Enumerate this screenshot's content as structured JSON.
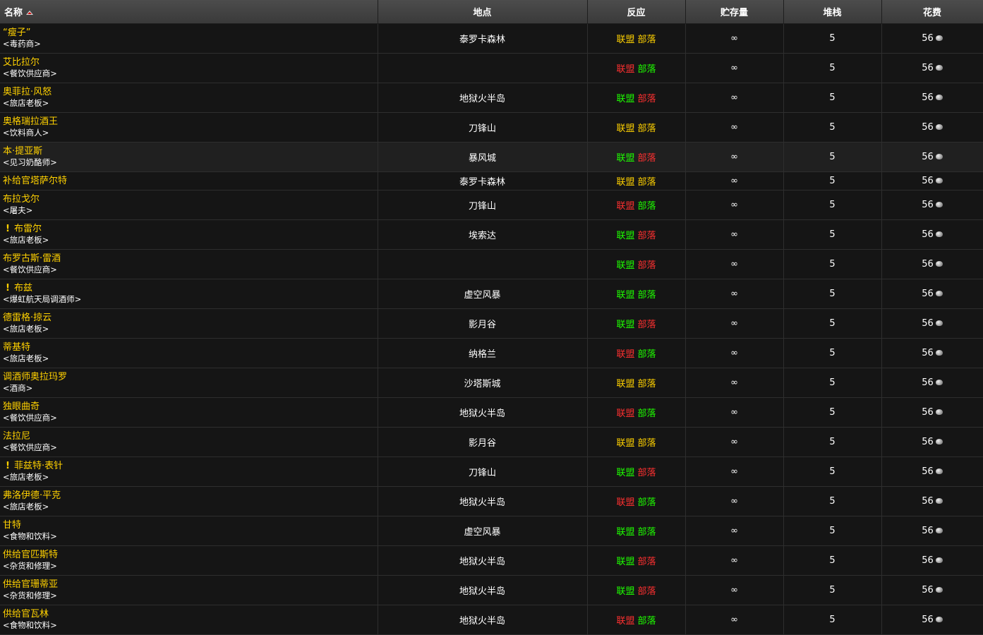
{
  "headers": {
    "name": "名称",
    "location": "地点",
    "reaction": "反应",
    "stock": "贮存量",
    "stack": "堆栈",
    "cost": "花费"
  },
  "reaction_labels": {
    "alliance": "联盟",
    "horde": "部落"
  },
  "colors": {
    "alliance_yellow": "#ffd100",
    "friendly_green": "#1eff00",
    "hostile_red": "#ff3030",
    "name_gold": "#ffd100"
  },
  "rows": [
    {
      "name": "“瘦子”",
      "title": "<毒药商>",
      "quest": false,
      "location": "泰罗卡森林",
      "alliance": "yellow",
      "horde": "yellow",
      "stock": "∞",
      "stack": "5",
      "cost": "56"
    },
    {
      "name": "艾比拉尔",
      "title": "<餐饮供应商>",
      "quest": false,
      "location": "",
      "alliance": "red",
      "horde": "green",
      "stock": "∞",
      "stack": "5",
      "cost": "56"
    },
    {
      "name": "奥菲拉·风怒",
      "title": "<旅店老板>",
      "quest": false,
      "location": "地狱火半岛",
      "alliance": "green",
      "horde": "red",
      "stock": "∞",
      "stack": "5",
      "cost": "56"
    },
    {
      "name": "奥格瑞拉酒王",
      "title": "<饮料商人>",
      "quest": false,
      "location": "刀锋山",
      "alliance": "yellow",
      "horde": "yellow",
      "stock": "∞",
      "stack": "5",
      "cost": "56"
    },
    {
      "name": "本·提亚斯",
      "title": "<见习奶酪师>",
      "quest": false,
      "location": "暴风城",
      "alliance": "green",
      "horde": "red",
      "stock": "∞",
      "stack": "5",
      "cost": "56",
      "highlight": true
    },
    {
      "name": "补给官塔萨尔特",
      "title": "",
      "quest": false,
      "location": "泰罗卡森林",
      "alliance": "yellow",
      "horde": "yellow",
      "stock": "∞",
      "stack": "5",
      "cost": "56",
      "short": true
    },
    {
      "name": "布拉戈尔",
      "title": "<屠夫>",
      "quest": false,
      "location": "刀锋山",
      "alliance": "red",
      "horde": "green",
      "stock": "∞",
      "stack": "5",
      "cost": "56"
    },
    {
      "name": "布雷尔",
      "title": "<旅店老板>",
      "quest": true,
      "location": "埃索达",
      "alliance": "green",
      "horde": "red",
      "stock": "∞",
      "stack": "5",
      "cost": "56"
    },
    {
      "name": "布罗古斯·雷酒",
      "title": "<餐饮供应商>",
      "quest": false,
      "location": "",
      "alliance": "green",
      "horde": "red",
      "stock": "∞",
      "stack": "5",
      "cost": "56"
    },
    {
      "name": "布兹",
      "title": "<爆虹航天局调酒师>",
      "quest": true,
      "location": "虚空风暴",
      "alliance": "green",
      "horde": "green",
      "stock": "∞",
      "stack": "5",
      "cost": "56"
    },
    {
      "name": "德雷格·掠云",
      "title": "<旅店老板>",
      "quest": false,
      "location": "影月谷",
      "alliance": "green",
      "horde": "red",
      "stock": "∞",
      "stack": "5",
      "cost": "56"
    },
    {
      "name": "蒂基特",
      "title": "<旅店老板>",
      "quest": false,
      "location": "纳格兰",
      "alliance": "red",
      "horde": "green",
      "stock": "∞",
      "stack": "5",
      "cost": "56"
    },
    {
      "name": "调酒师奥拉玛罗",
      "title": "<酒商>",
      "quest": false,
      "location": "沙塔斯城",
      "alliance": "yellow",
      "horde": "yellow",
      "stock": "∞",
      "stack": "5",
      "cost": "56"
    },
    {
      "name": "独眼曲奇",
      "title": "<餐饮供应商>",
      "quest": false,
      "location": "地狱火半岛",
      "alliance": "red",
      "horde": "green",
      "stock": "∞",
      "stack": "5",
      "cost": "56"
    },
    {
      "name": "法拉尼",
      "title": "<餐饮供应商>",
      "quest": false,
      "location": "影月谷",
      "alliance": "yellow",
      "horde": "yellow",
      "stock": "∞",
      "stack": "5",
      "cost": "56"
    },
    {
      "name": "菲兹特·表针",
      "title": "<旅店老板>",
      "quest": true,
      "location": "刀锋山",
      "alliance": "green",
      "horde": "red",
      "stock": "∞",
      "stack": "5",
      "cost": "56"
    },
    {
      "name": "弗洛伊德·平克",
      "title": "<旅店老板>",
      "quest": false,
      "location": "地狱火半岛",
      "alliance": "red",
      "horde": "green",
      "stock": "∞",
      "stack": "5",
      "cost": "56"
    },
    {
      "name": "甘特",
      "title": "<食物和饮料>",
      "quest": false,
      "location": "虚空风暴",
      "alliance": "green",
      "horde": "green",
      "stock": "∞",
      "stack": "5",
      "cost": "56"
    },
    {
      "name": "供给官匹斯特",
      "title": "<杂货和修理>",
      "quest": false,
      "location": "地狱火半岛",
      "alliance": "green",
      "horde": "red",
      "stock": "∞",
      "stack": "5",
      "cost": "56"
    },
    {
      "name": "供给官珊蒂亚",
      "title": "<杂货和修理>",
      "quest": false,
      "location": "地狱火半岛",
      "alliance": "green",
      "horde": "red",
      "stock": "∞",
      "stack": "5",
      "cost": "56"
    },
    {
      "name": "供给官瓦林",
      "title": "<食物和饮料>",
      "quest": false,
      "location": "地狱火半岛",
      "alliance": "red",
      "horde": "green",
      "stock": "∞",
      "stack": "5",
      "cost": "56"
    }
  ]
}
